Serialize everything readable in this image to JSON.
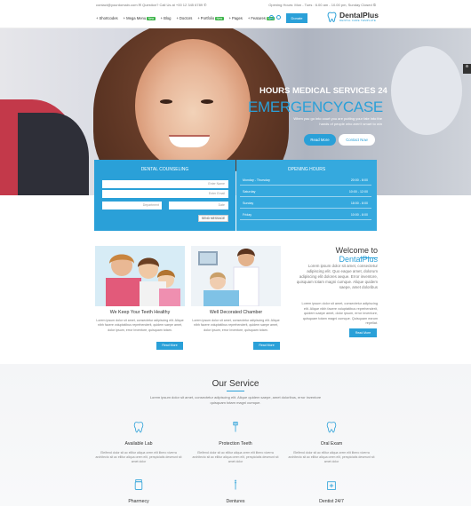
{
  "topbar": {
    "contact": "contact@yourdomain.com  ✉  Question? Call Us at +00 12 345 6789 ✆",
    "hours": "Opening Hours: Mon - Tues : 6.00 am - 10.00 pm, Sunday Closed ⏲"
  },
  "nav": {
    "items": [
      {
        "label": "Shortcodes",
        "badge": ""
      },
      {
        "label": "Mega Menu",
        "badge": "New"
      },
      {
        "label": "Blog",
        "badge": ""
      },
      {
        "label": "Doctors",
        "badge": ""
      },
      {
        "label": "Portfolio",
        "badge": "New"
      },
      {
        "label": "Pages",
        "badge": ""
      },
      {
        "label": "Features",
        "badge": "New"
      }
    ],
    "donate": "Donate"
  },
  "logo": {
    "name": "DentalPlus",
    "tagline": "DENTAL CARE TEMPLATE"
  },
  "hero": {
    "line1": "HOURS MEDICAL SERVICES 24",
    "line2": "EMERGENCYCASE",
    "line3": "When you go into court you are putting your fate into the hands of people who aren't smart to win",
    "read_more": "Read More",
    "contact": "Contact Now"
  },
  "counseling": {
    "title": "DENTAL COUNSELING",
    "name_placeholder": "Enter Name",
    "email_placeholder": "Enter Email",
    "department_placeholder": "Department",
    "date_placeholder": "Date",
    "send": "SEND MESSAGE"
  },
  "hours": {
    "title": "OPENING HOURS",
    "rows": [
      {
        "day": "Monday - Thursday",
        "time": "20:00 - 8:00"
      },
      {
        "day": "Saturday",
        "time": "10:00 - 12:00"
      },
      {
        "day": "Sunday",
        "time": "18:00 - 8:00"
      },
      {
        "day": "Friday",
        "time": "10:00 - 8:00"
      }
    ]
  },
  "cards": [
    {
      "title": "We Keep Your Teeth Healthy",
      "text": "Lorem ipsum dolor sit amet, consectetur adipiscing elit. Alique nibh facere voluptatibus reprehenderit, quidem saepe amet, dolor ipsum, error inventore, quisquam totam.",
      "button": "Read More"
    },
    {
      "title": "Well Decorated Chamber",
      "text": "Lorem ipsum dolor sit amet, consectetur adipiscing elit. Alique nibh facere voluptatibus reprehenderit, quidem saepe amet, dolor ipsum, error inventore, quisquam totam.",
      "button": "Read More"
    }
  ],
  "welcome": {
    "prefix": "Welcome to ",
    "brand": "DentalPlus",
    "text": "Lorem ipsum dolor sit amet, consectetur adipiscing elit. Quo eaque amet, dolorum adipiscing elit dolores aeque. Error inventore, quisquam totam magni cumque. Alique quidem saepe, amet doloribus",
    "text2": "Lorem ipsum dolor sit amet, consectetur adipiscing elit. Alique nibh facere voluptatibus reprehenderit, quidem saepe amet, dolor ipsum, error inventore, quisquam totam magni cumque. Quisquam earum repellat.",
    "button": "Read More"
  },
  "service": {
    "title": "Our Service",
    "desc": "Lorem ipsum dolor sit amet, consectetur adipiscing elit. Alique quidem saepe, amet doloribus, error inventore quisquam totam magni cumque.",
    "items": [
      {
        "name": "Available Lab",
        "text": "Eleifend dolor sit ac ellitur aliqua orem elit libero viverra architecto sit ac ellitur aliqua orem elit, perspiciatis deserunt sit amet dolor"
      },
      {
        "name": "Protection Teeth",
        "text": "Eleifend dolor sit ac ellitur aliqua orem elit libero viverra architecto sit ac ellitur aliqua orem elit, perspiciatis deserunt sit amet dolor"
      },
      {
        "name": "Oral Exam",
        "text": "Eleifend dolor sit ac ellitur aliqua orem elit libero viverra architecto sit ac ellitur aliqua orem elit, perspiciatis deserunt sit amet dolor"
      },
      {
        "name": "Pharmecy"
      },
      {
        "name": "Dentures"
      },
      {
        "name": "Dentist 24/7"
      }
    ]
  },
  "colors": {
    "accent": "#2aa0d8",
    "badge": "#3db54a"
  }
}
